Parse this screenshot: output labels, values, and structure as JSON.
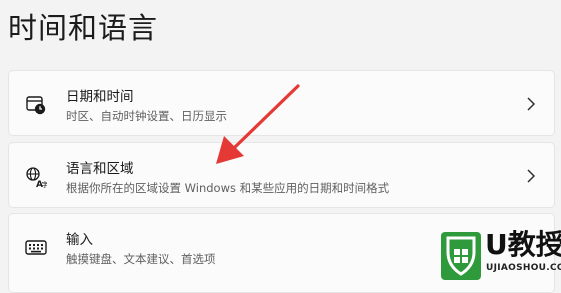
{
  "page": {
    "title": "时间和语言"
  },
  "cards": [
    {
      "id": "datetime",
      "title": "日期和时间",
      "desc": "时区、自动时钟设置、日历显示",
      "icon": "clock-calendar-icon"
    },
    {
      "id": "language",
      "title": "语言和区域",
      "desc": "根据你所在的区域设置 Windows 和某些应用的日期和时间格式",
      "icon": "language-icon"
    },
    {
      "id": "input",
      "title": "输入",
      "desc": "触摸键盘、文本建议、首选项",
      "icon": "keyboard-icon"
    }
  ],
  "annotation": {
    "arrow_color": "#e53935"
  },
  "watermark": {
    "brand": "U教授",
    "site": "UJIAOSHOU.COM",
    "color": "#2e9a3c"
  }
}
